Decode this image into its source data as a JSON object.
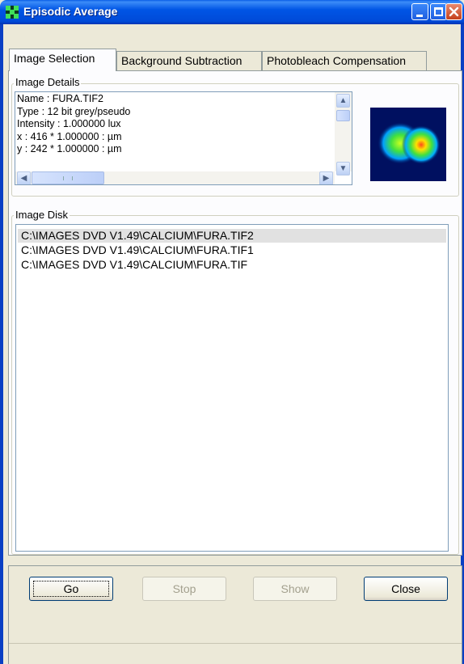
{
  "window": {
    "title": "Episodic Average"
  },
  "tabs": [
    {
      "label": "Image Selection",
      "active": true
    },
    {
      "label": "Background Subtraction",
      "active": false
    },
    {
      "label": "Photobleach Compensation",
      "active": false
    }
  ],
  "image_details": {
    "label": "Image Details",
    "lines": [
      "Name : FURA.TIF2",
      "Type : 12 bit grey/pseudo",
      "Intensity : 1.000000 lux",
      "x : 416 * 1.000000 : µm",
      "y : 242 * 1.000000 : µm"
    ]
  },
  "image_disk": {
    "label": "Image Disk",
    "items": [
      {
        "path": "C:\\IMAGES DVD V1.49\\CALCIUM\\FURA.TIF2",
        "selected": true
      },
      {
        "path": "C:\\IMAGES DVD V1.49\\CALCIUM\\FURA.TIF1",
        "selected": false
      },
      {
        "path": "C:\\IMAGES DVD V1.49\\CALCIUM\\FURA.TIF",
        "selected": false
      }
    ]
  },
  "buttons": {
    "go": "Go",
    "stop": "Stop",
    "show": "Show",
    "close": "Close"
  },
  "colors": {
    "titlebar": "#0055e5",
    "selection": "#e1e1e1",
    "preview_bg": "#001060"
  },
  "icons": {
    "app": "app-grid-icon",
    "minimize": "minimize-icon",
    "maximize": "maximize-icon",
    "close": "close-icon"
  }
}
